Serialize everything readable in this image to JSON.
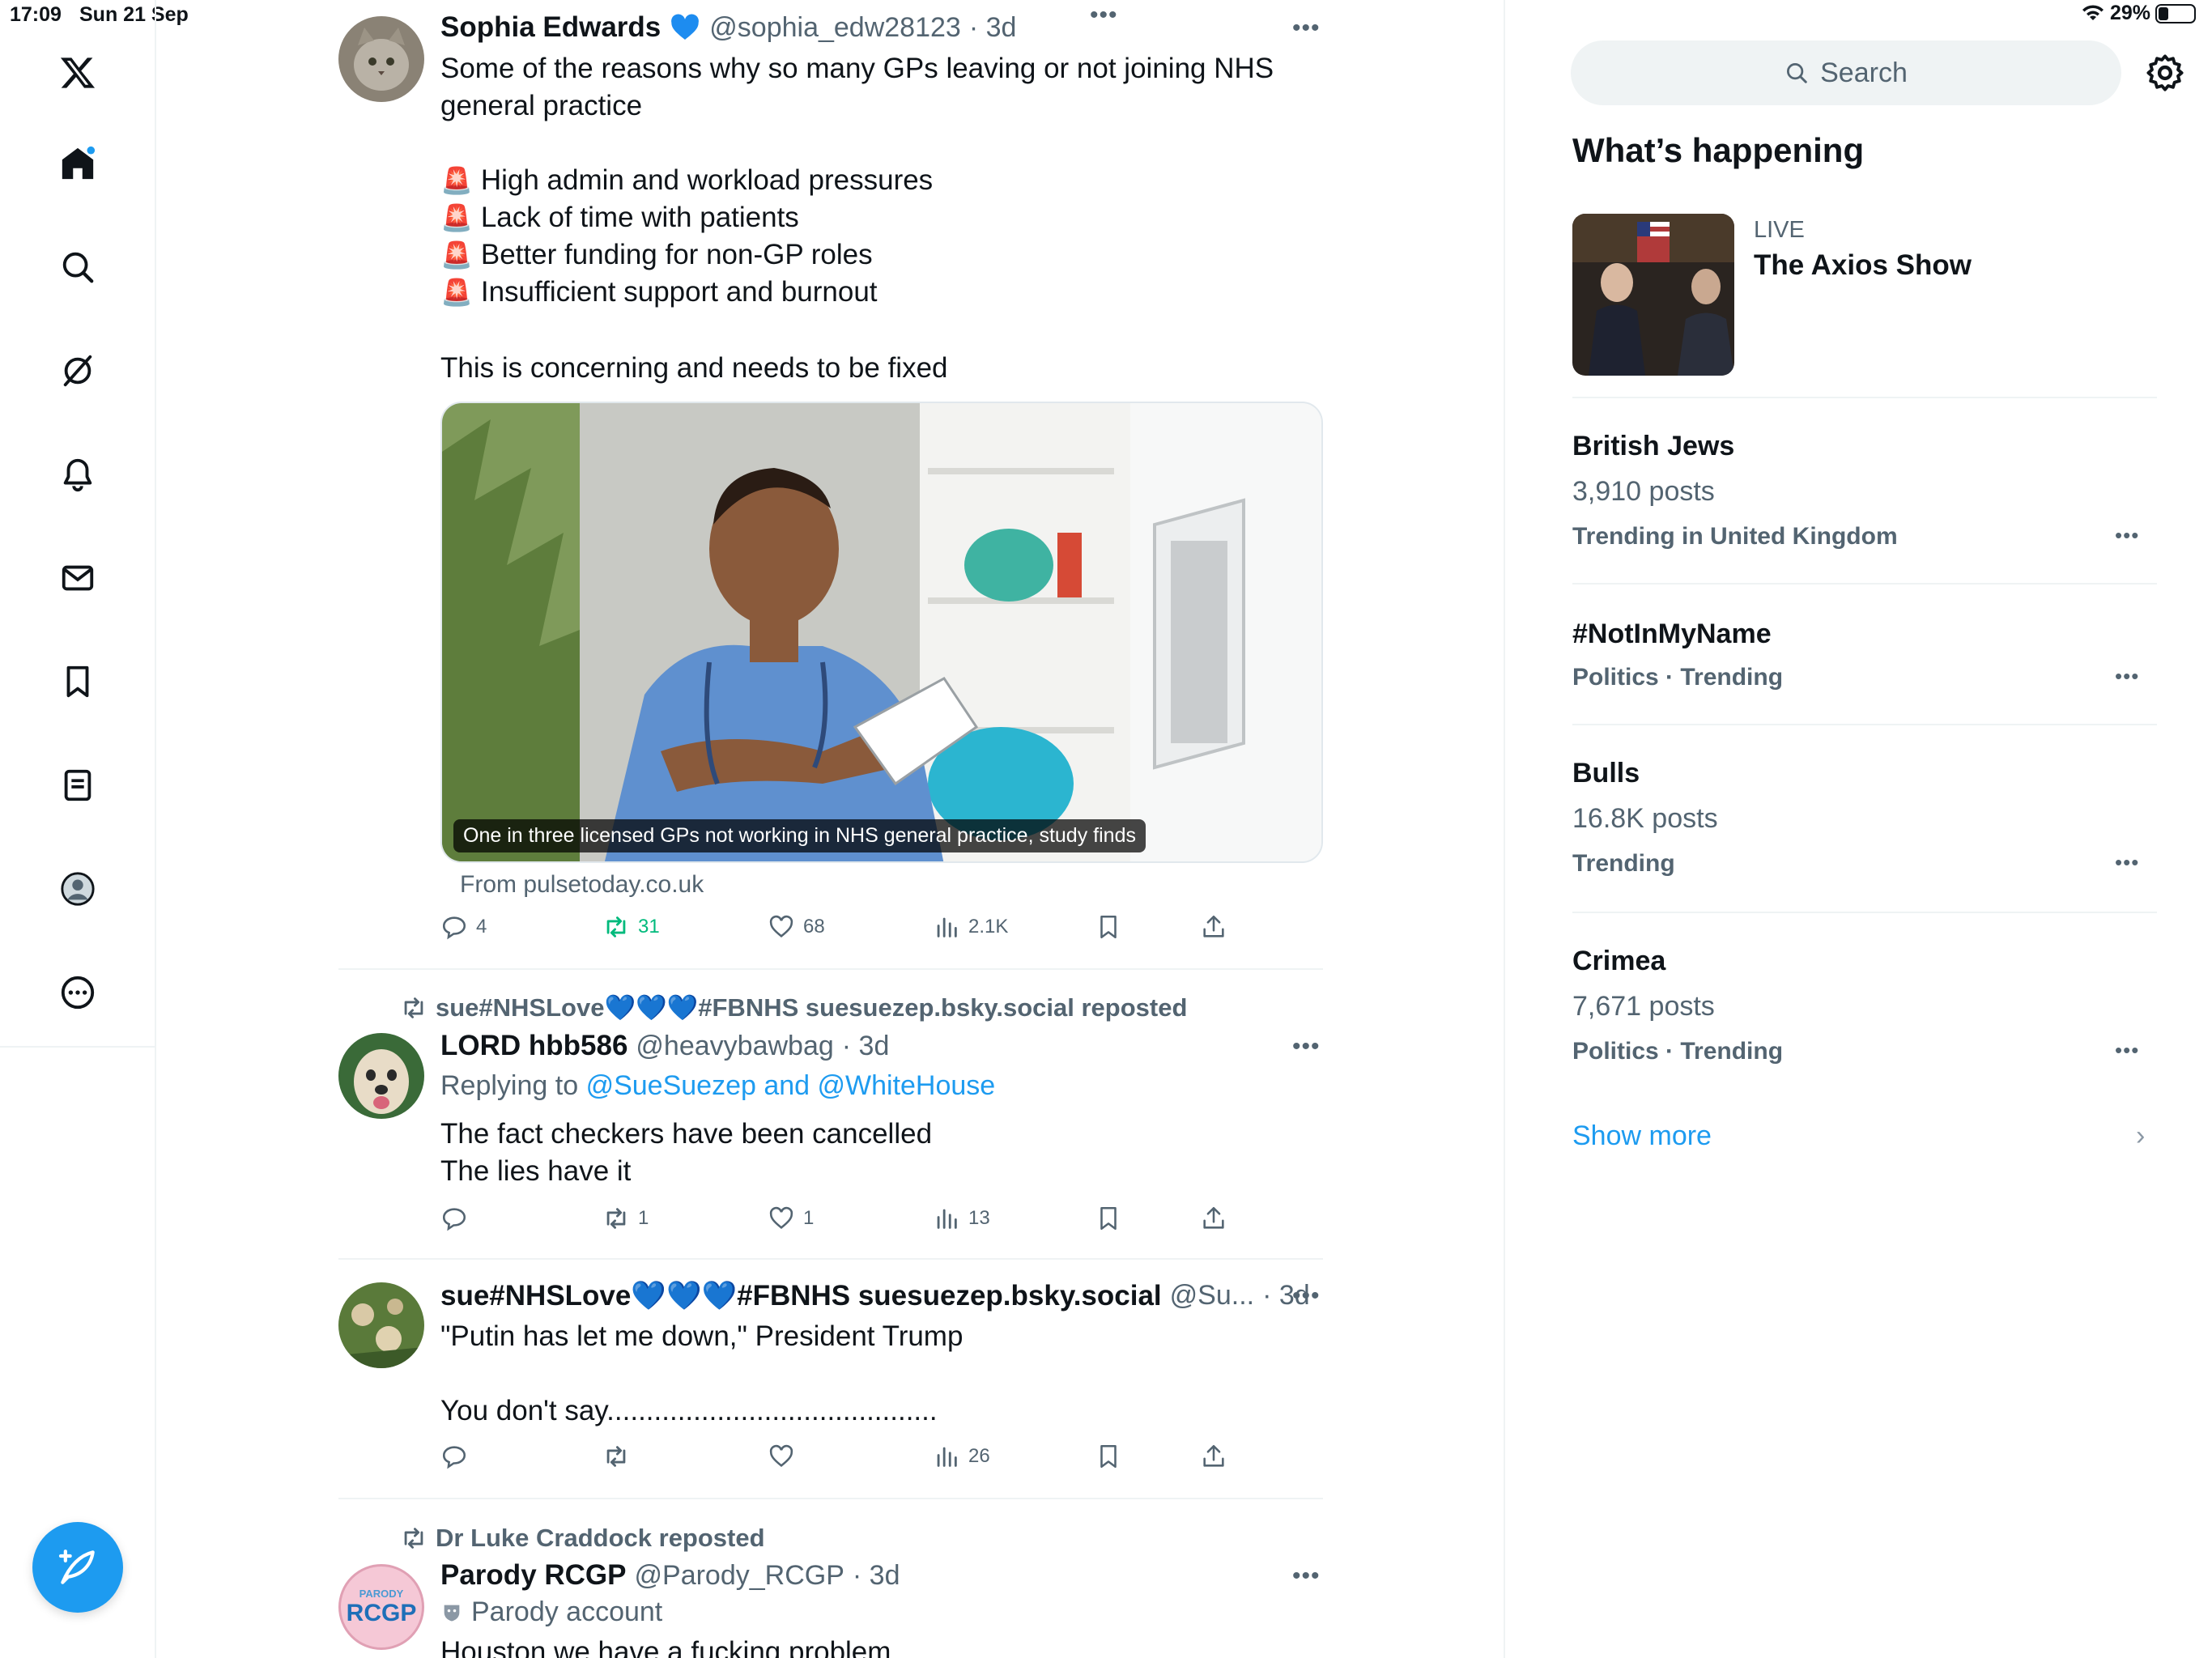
{
  "status_bar": {
    "time": "17:09",
    "date": "Sun 21 Sep",
    "battery": "29%"
  },
  "sidebar": {
    "items": [
      "X logo",
      "Home",
      "Search",
      "Grok",
      "Notifications",
      "Messages",
      "Bookmarks",
      "Lists",
      "Profile",
      "More"
    ]
  },
  "tweets": [
    {
      "name": "Sophia Edwards",
      "handle": "@sophia_edw28123",
      "time": "· 3d",
      "text": "Some of the reasons why so many GPs leaving or not joining NHS general practice",
      "bullets": [
        "High admin and workload pressures",
        "Lack of time with patients",
        "Better funding for non-GP roles",
        "Insufficient support and burnout"
      ],
      "closing": "This is concerning and needs to be fixed",
      "media_caption": "One in three licensed GPs not working in NHS general practice, study finds",
      "from": "From pulsetoday.co.uk",
      "replies": "4",
      "reposts": "31",
      "likes": "68",
      "views": "2.1K"
    },
    {
      "repost_by": "sue#NHSLove💙💙💙#FBNHS suesuezep.bsky.social reposted",
      "name": "LORD hbb586",
      "handle": "@heavybawbag",
      "time": "· 3d",
      "replying_prefix": "Replying to",
      "replying_to": "@SueSuezep and @WhiteHouse",
      "text": "The fact checkers have been cancelled\nThe lies have it",
      "replies": "",
      "reposts": "1",
      "likes": "1",
      "views": "13"
    },
    {
      "name": "sue#NHSLove💙💙💙#FBNHS suesuezep.bsky.social",
      "handle": "@Su...",
      "time": "· 3d",
      "text": "\"Putin has let me down,\" President Trump\n\nYou don't say..........................................",
      "replies": "",
      "reposts": "",
      "likes": "",
      "views": "26"
    },
    {
      "repost_by": "Dr Luke Craddock reposted",
      "name": "Parody RCGP",
      "handle": "@Parody_RCGP",
      "time": "· 3d",
      "badge": "Parody account",
      "avatar_top": "PARODY",
      "avatar_main": "RCGP",
      "text": "Houston we have a fucking problem"
    }
  ],
  "right_panel": {
    "search_placeholder": "Search",
    "section_title": "What’s happening",
    "live": {
      "label": "LIVE",
      "title": "The Axios Show"
    },
    "trends": [
      {
        "name": "British Jews",
        "count": "3,910 posts",
        "context": "Trending in United Kingdom"
      },
      {
        "name": "#NotInMyName",
        "count": "",
        "context": "Politics · Trending"
      },
      {
        "name": "Bulls",
        "count": "16.8K posts",
        "context": "Trending"
      },
      {
        "name": "Crimea",
        "count": "7,671 posts",
        "context": "Politics · Trending"
      }
    ],
    "show_more": "Show more"
  },
  "colors": {
    "accent": "#1d9bf0",
    "repost_green": "#00ba7c",
    "muted": "#536471"
  }
}
